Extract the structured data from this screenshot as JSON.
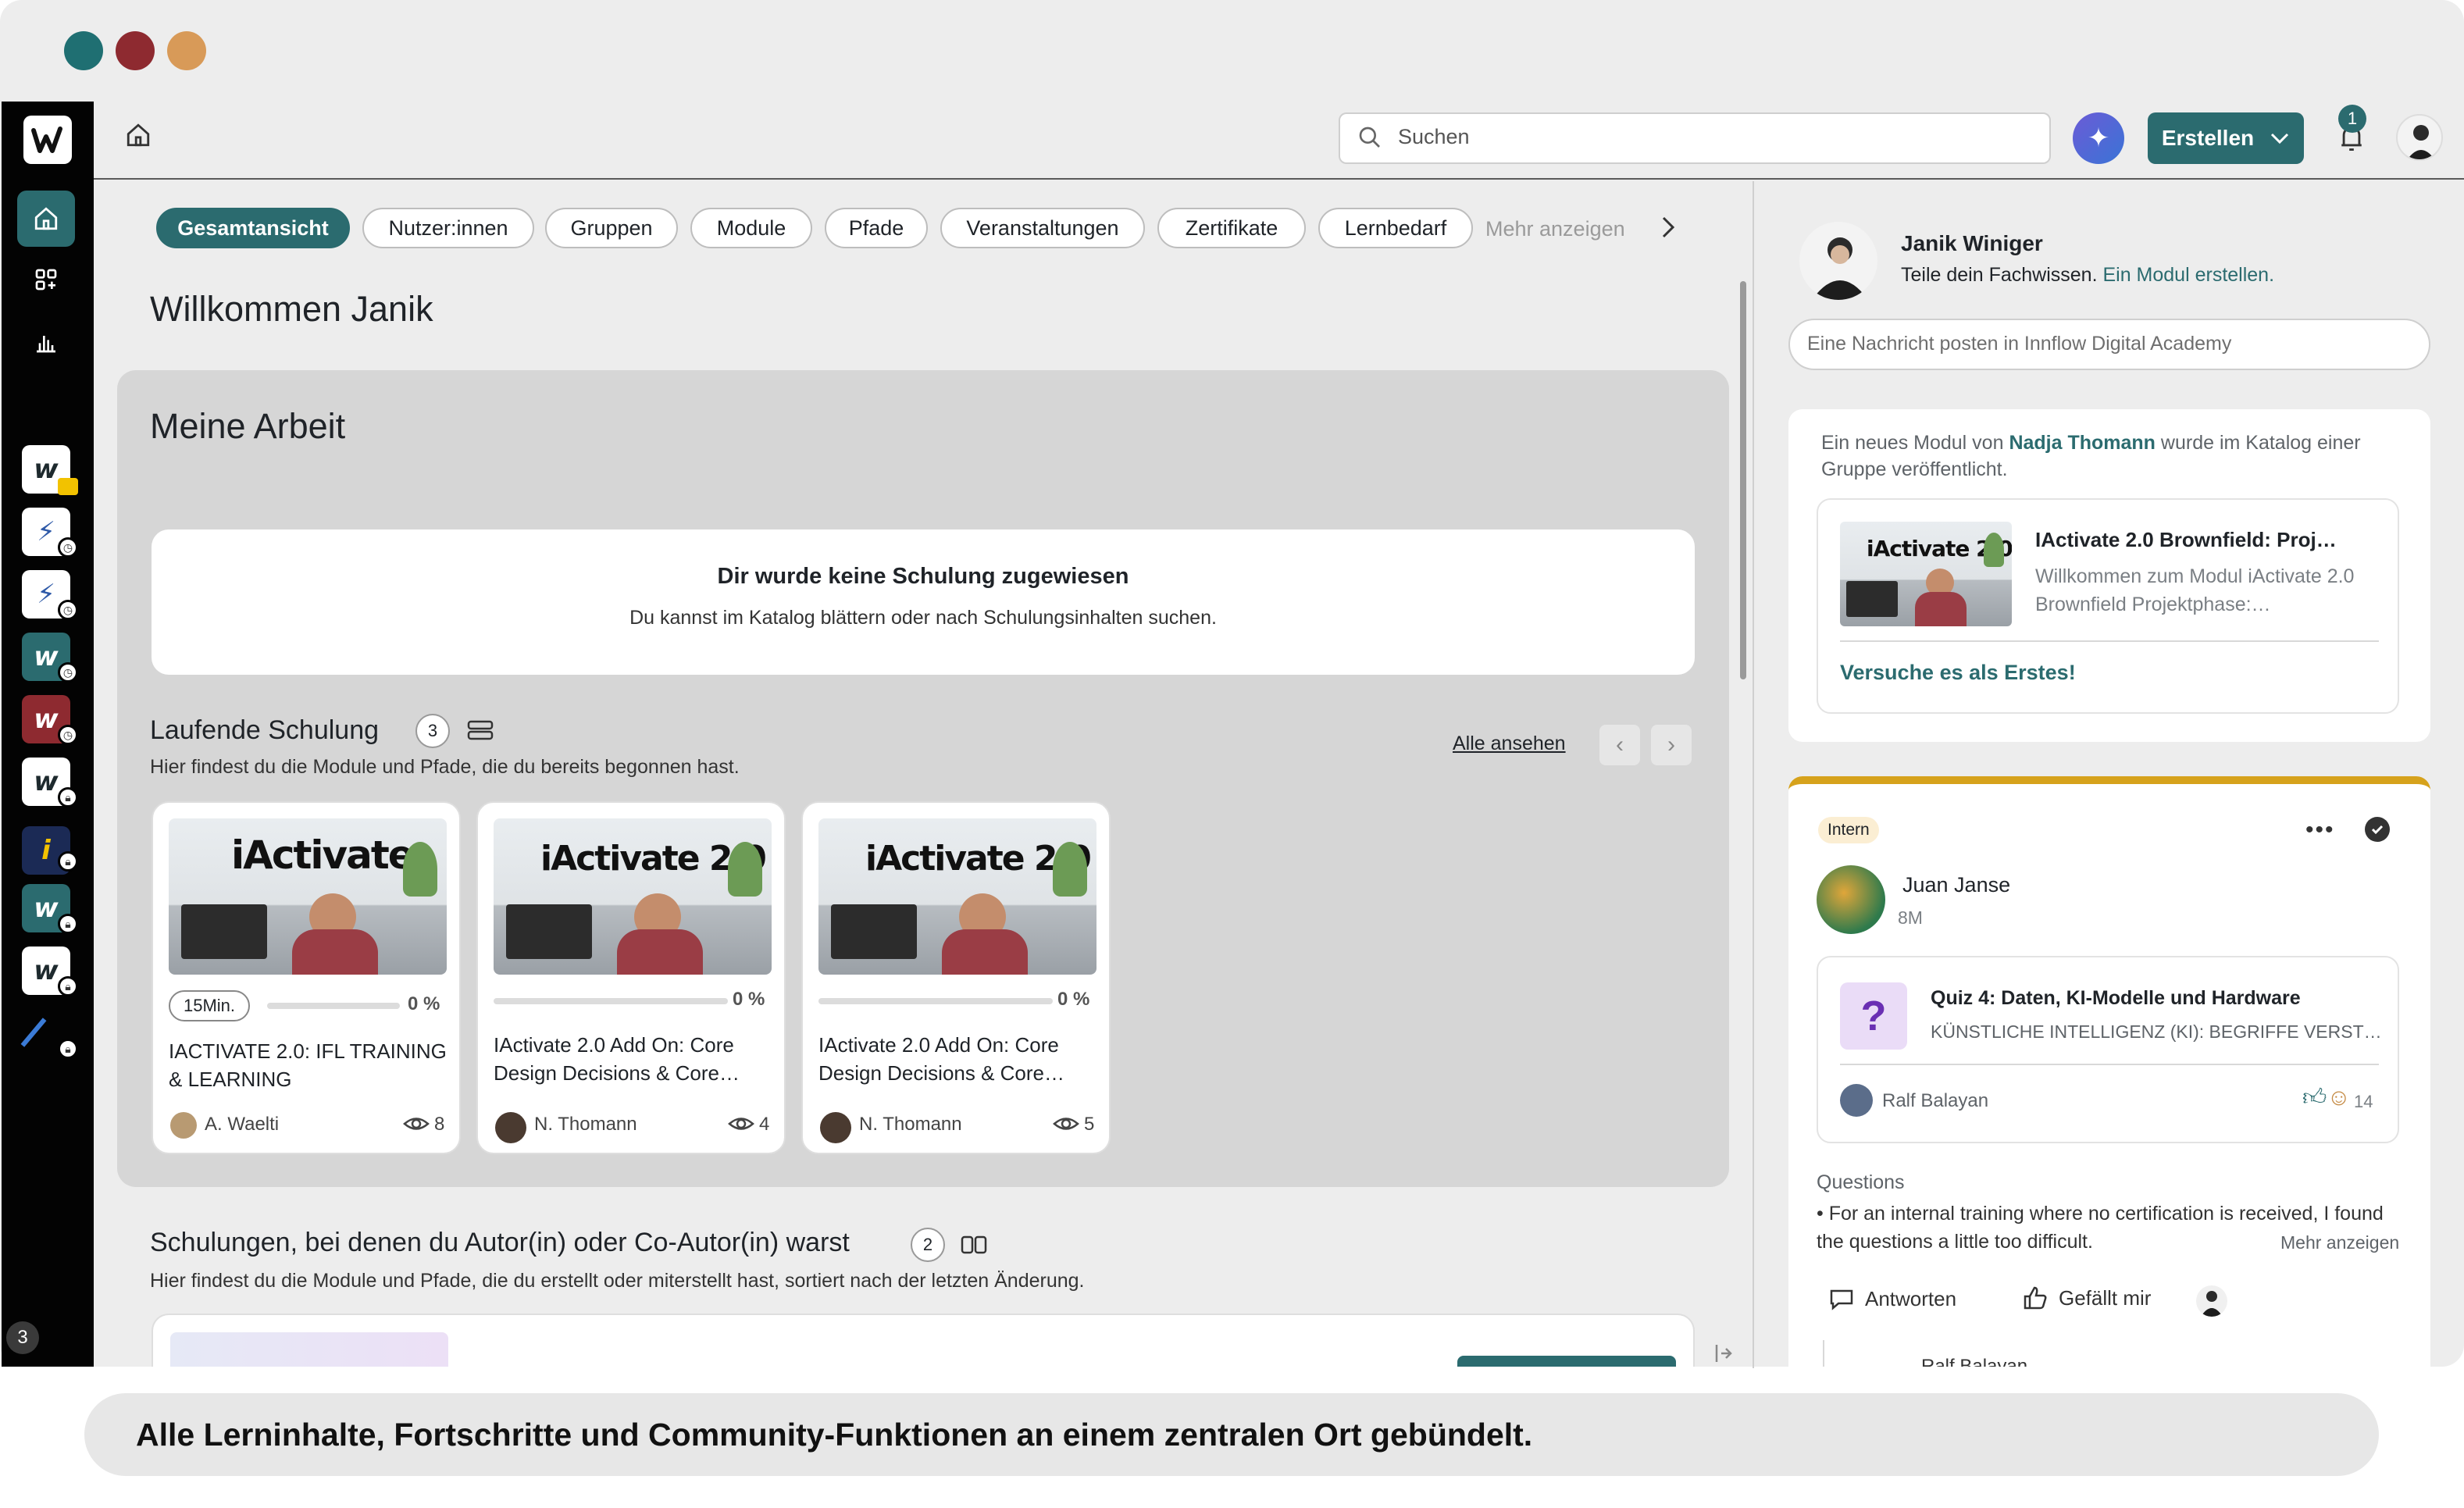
{
  "window": {
    "dots": [
      "#1f6f72",
      "#8e2a30",
      "#d89a58"
    ]
  },
  "sidebar": {
    "bottom_badge": "3"
  },
  "header": {
    "search_placeholder": "Suchen",
    "create_label": "Erstellen",
    "notification_count": "1"
  },
  "tabs": [
    {
      "label": "Gesamtansicht",
      "active": true
    },
    {
      "label": "Nutzer:innen"
    },
    {
      "label": "Gruppen"
    },
    {
      "label": "Module"
    },
    {
      "label": "Pfade"
    },
    {
      "label": "Veranstaltungen"
    },
    {
      "label": "Zertifikate"
    },
    {
      "label": "Lernbedarf"
    }
  ],
  "more_tabs_label": "Mehr anzeigen",
  "welcome_title": "Willkommen Janik",
  "my_work": {
    "title": "Meine Arbeit",
    "empty_title": "Dir wurde keine Schulung zugewiesen",
    "empty_subtitle": "Du kannst im Katalog blättern oder nach Schulungsinhalten suchen."
  },
  "running": {
    "title": "Laufende Schulung",
    "count": "3",
    "subtitle": "Hier findest du die Module und Pfade, die du bereits begonnen hast.",
    "see_all": "Alle ansehen",
    "courses": [
      {
        "thumb_text": "iActivate",
        "duration": "15Min.",
        "progress": "0 %",
        "title": "IACTIVATE 2.0: IFL TRAINING & LEARNING",
        "author": "A. Waelti",
        "views": "8"
      },
      {
        "thumb_text": "iActivate 2.0",
        "progress": "0 %",
        "title": "IActivate 2.0 Add On: Core Design Decisions & Core…",
        "author": "N. Thomann",
        "views": "4"
      },
      {
        "thumb_text": "iActivate 2.0",
        "progress": "0 %",
        "title": "IActivate 2.0 Add On: Core Design Decisions & Core…",
        "author": "N. Thomann",
        "views": "5"
      }
    ]
  },
  "authored": {
    "title": "Schulungen, bei denen du Autor(in) oder Co-Autor(in) warst",
    "count": "2",
    "subtitle": "Hier findest du die Module und Pfade, die du erstellt oder miterstellt hast, sortiert nach der letzten Änderung."
  },
  "feed": {
    "user_name": "Janik Winiger",
    "share_text": "Teile dein Fachwissen.",
    "share_link": "Ein Modul erstellen.",
    "post_placeholder": "Eine Nachricht posten in Innflow Digital Academy",
    "notice": {
      "prefix": "Ein neues Modul von",
      "author": "Nadja Thomann",
      "suffix": "wurde im Katalog einer Gruppe veröffentlicht.",
      "thumb_text": "iActivate 2.0",
      "module_title": "IActivate 2.0 Brownfield: Proj…",
      "module_desc": "Willkommen zum Modul iActivate 2.0 Brownfield Projektphase:…",
      "cta": "Versuche es als Erstes!"
    },
    "post": {
      "tag": "Intern",
      "author": "Juan Janse",
      "time": "8M",
      "quiz_title": "Quiz 4: Daten, KI-Modelle und Hardware",
      "quiz_subtitle": "KÜNSTLICHE INTELLIGENZ (KI): BEGRIFFE VERST…",
      "quiz_author": "Ralf Balayan",
      "reactions": "14",
      "questions_label": "Questions",
      "questions_text": "• For an internal training where no certification is received, I found the questions a little too difficult.",
      "more": "Mehr anzeigen",
      "reply": "Antworten",
      "like": "Gefällt mir",
      "next_comment_author": "Ralf Balayan"
    }
  },
  "caption": "Alle Lerninhalte, Fortschritte und Community-Funktionen an einem zentralen Ort gebündelt."
}
